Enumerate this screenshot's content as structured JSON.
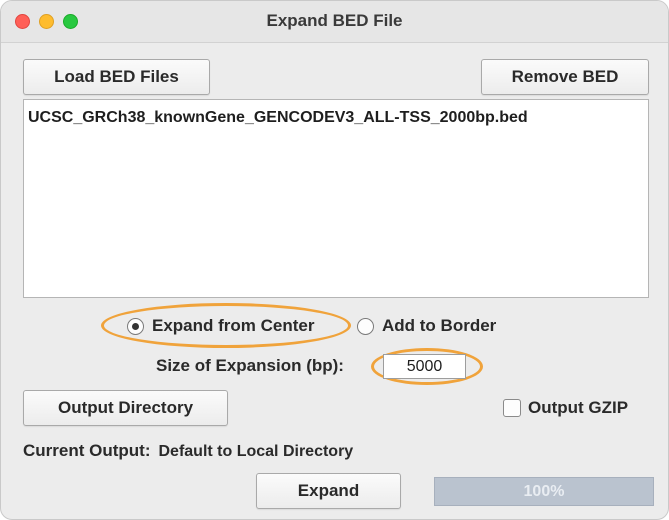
{
  "window": {
    "title": "Expand BED File"
  },
  "toolbar": {
    "load_label": "Load BED Files",
    "remove_label": "Remove BED"
  },
  "file_list": {
    "items": [
      "UCSC_GRCh38_knownGene_GENCODEV3_ALL-TSS_2000bp.bed"
    ]
  },
  "expansion_mode": {
    "options": [
      {
        "label": "Expand from Center",
        "selected": true
      },
      {
        "label": "Add to Border",
        "selected": false
      }
    ]
  },
  "size": {
    "label": "Size of Expansion (bp):",
    "value": "5000"
  },
  "output": {
    "directory_label": "Output Directory",
    "gzip_label": "Output GZIP",
    "gzip_checked": false,
    "current_caption": "Current Output:",
    "current_value": "Default to Local Directory"
  },
  "actions": {
    "expand_label": "Expand"
  },
  "progress": {
    "text": "100%",
    "fraction": 1.0
  },
  "colors": {
    "highlight": "#f0a33b",
    "progress_fill": "#bac3cf",
    "traffic_red": "#ff5f57",
    "traffic_yellow": "#febc2e",
    "traffic_green": "#28c840"
  }
}
